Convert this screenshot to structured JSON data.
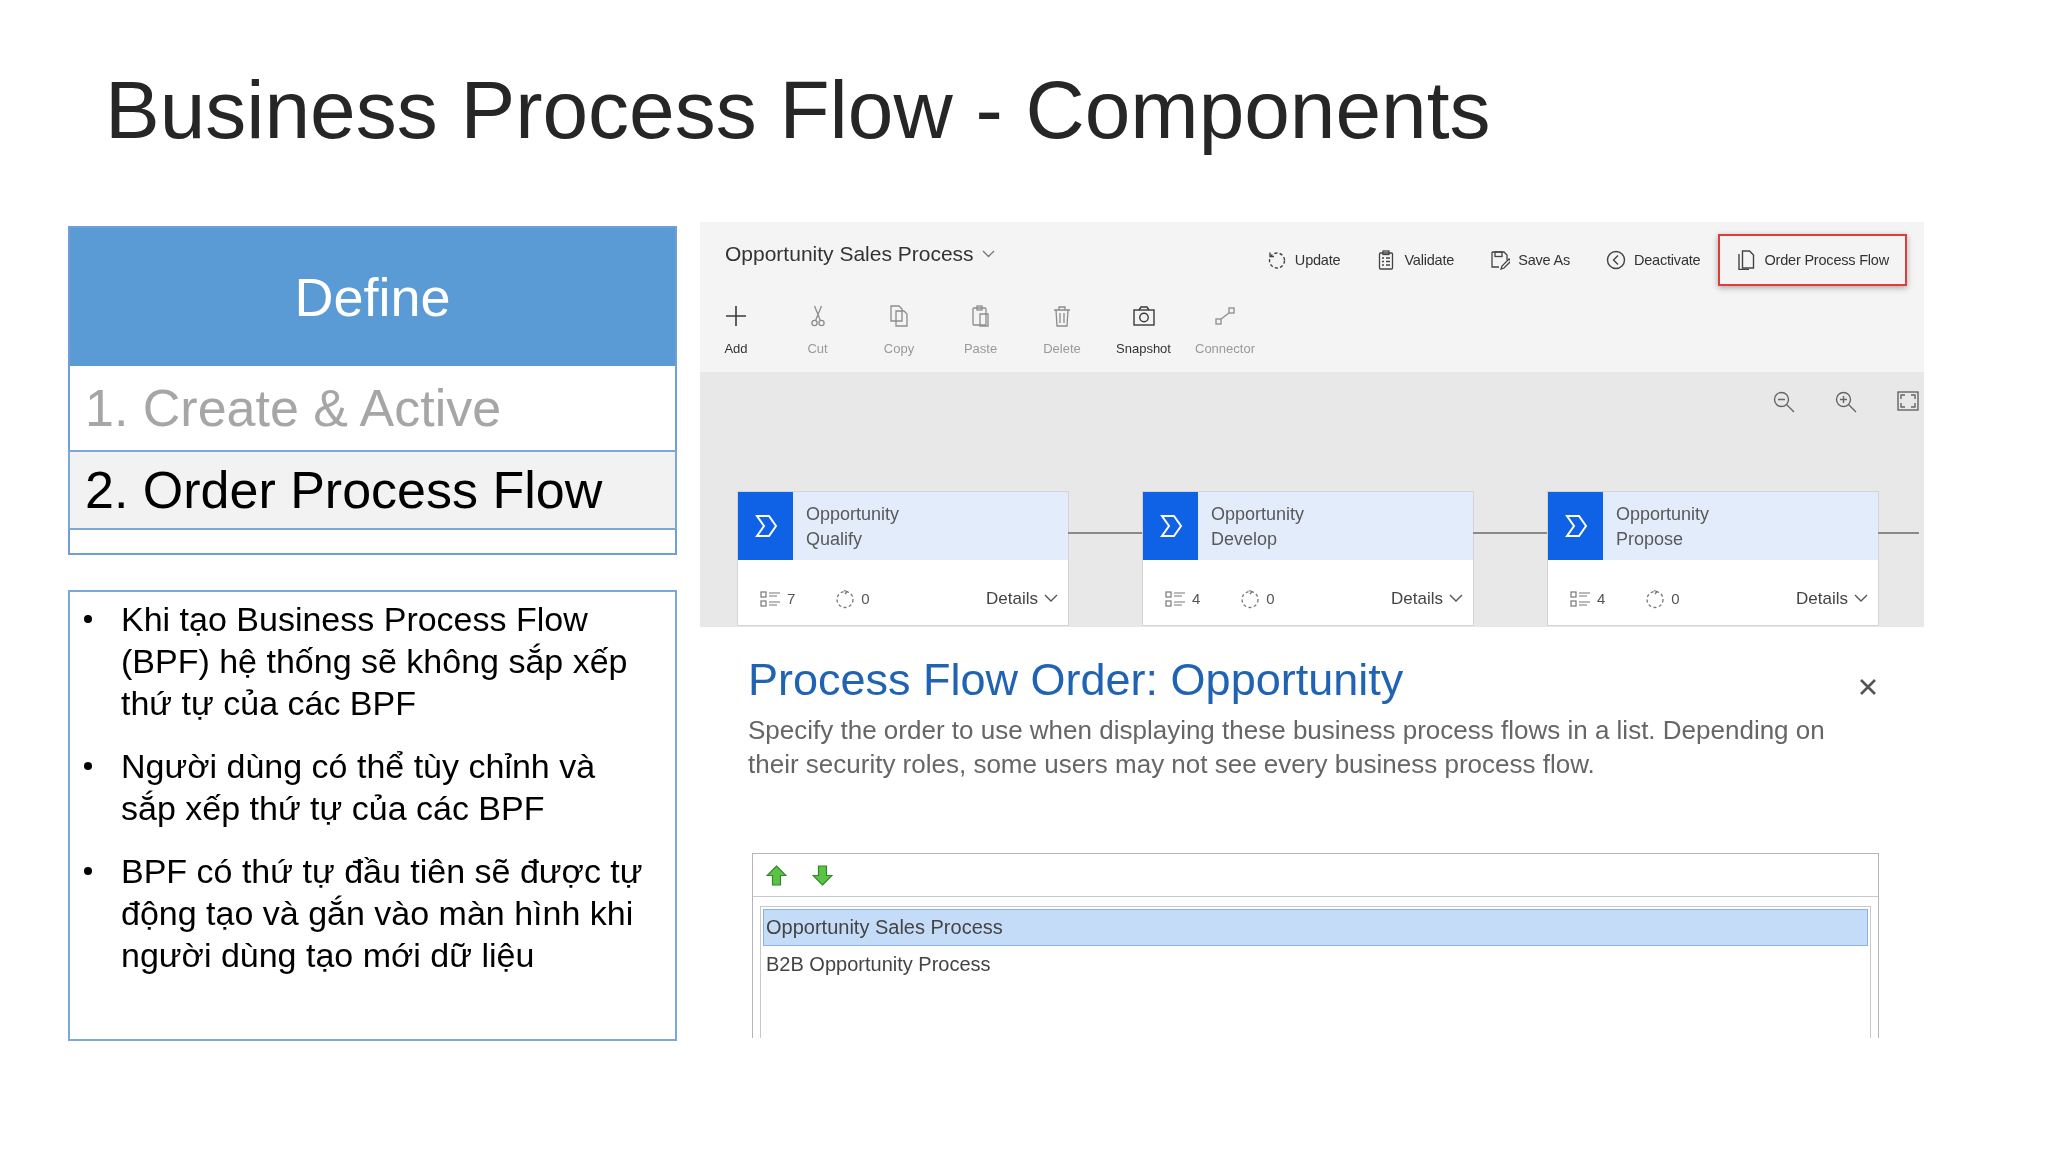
{
  "slide": {
    "title": "Business Process Flow - Components"
  },
  "define_panel": {
    "header": "Define",
    "steps": [
      {
        "label": "1. Create & Active",
        "selected": false
      },
      {
        "label": "2. Order Process Flow",
        "selected": true
      }
    ]
  },
  "notes": {
    "bullets": [
      "Khi tạo Business Process Flow (BPF) hệ thống sẽ không sắp xếp thứ tự của các BPF",
      "Người dùng có thể tùy chỉnh và sắp xếp thứ tự của các BPF",
      "BPF có thứ tự đầu tiên sẽ được tự động tạo và gắn vào màn hình khi người dùng tạo mới dữ liệu"
    ]
  },
  "designer": {
    "process_name": "Opportunity Sales Process",
    "actions": [
      {
        "label": "Update",
        "highlighted": false
      },
      {
        "label": "Validate",
        "highlighted": false
      },
      {
        "label": "Save As",
        "highlighted": false
      },
      {
        "label": "Deactivate",
        "highlighted": false
      },
      {
        "label": "Order Process Flow",
        "highlighted": true
      }
    ],
    "tools": [
      {
        "label": "Add",
        "disabled": false
      },
      {
        "label": "Cut",
        "disabled": true
      },
      {
        "label": "Copy",
        "disabled": true
      },
      {
        "label": "Paste",
        "disabled": true
      },
      {
        "label": "Delete",
        "disabled": true
      },
      {
        "label": "Snapshot",
        "disabled": false
      },
      {
        "label": "Connector",
        "disabled": true
      }
    ],
    "stages": [
      {
        "name": "Opportunity Qualify",
        "steps": "7",
        "conditions": "0",
        "details": "Details"
      },
      {
        "name": "Opportunity Develop",
        "steps": "4",
        "conditions": "0",
        "details": "Details"
      },
      {
        "name": "Opportunity Propose",
        "steps": "4",
        "conditions": "0",
        "details": "Details"
      }
    ]
  },
  "order_dialog": {
    "title": "Process Flow Order: Opportunity",
    "description": "Specify the order to use when displaying these business process flows in a list. Depending on their security roles, some users may not see every business process flow.",
    "processes": [
      {
        "label": "Opportunity Sales Process",
        "selected": true
      },
      {
        "label": "B2B Opportunity Process",
        "selected": false
      }
    ]
  }
}
